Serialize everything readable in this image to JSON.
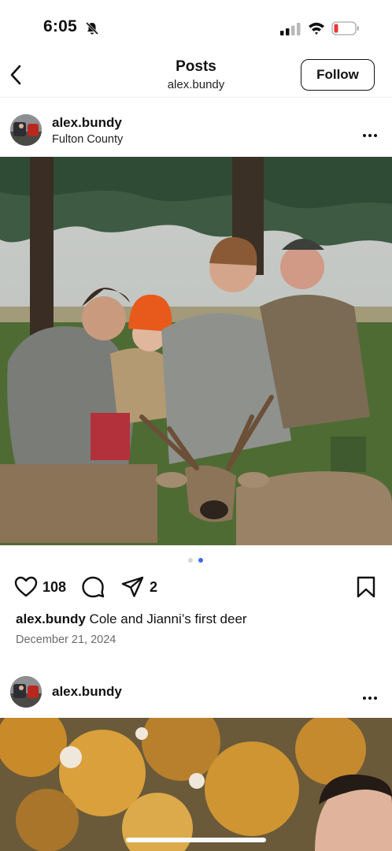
{
  "status_bar": {
    "time": "6:05"
  },
  "header": {
    "title": "Posts",
    "subtitle": "alex.bundy",
    "follow_label": "Follow"
  },
  "post1": {
    "username": "alex.bundy",
    "location": "Fulton County",
    "likes": "108",
    "shares": "2",
    "caption_user": "alex.bundy",
    "caption_text": "Cole and Jianni’s first deer",
    "date": "December 21, 2024",
    "carousel": {
      "count": 2,
      "active_index": 2
    }
  },
  "post2": {
    "username": "alex.bundy"
  },
  "colors": {
    "accent": "#3b6cf0",
    "text": "#111111",
    "muted": "#6b6b6b"
  }
}
